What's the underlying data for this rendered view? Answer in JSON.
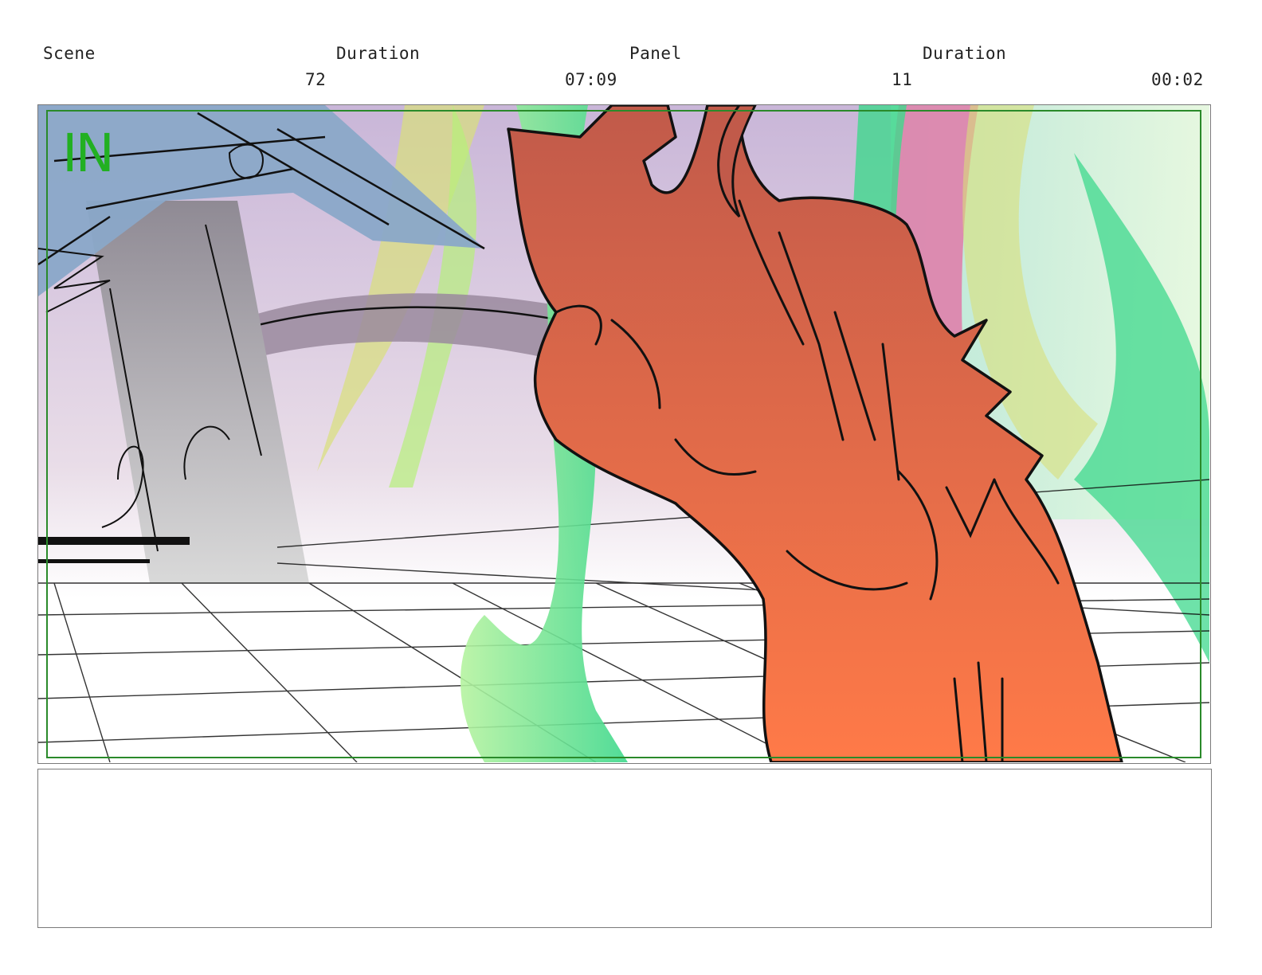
{
  "header": {
    "scene_label": "Scene",
    "scene_duration_label": "Duration",
    "panel_label": "Panel",
    "panel_duration_label": "Duration",
    "scene_number": "72",
    "scene_duration": "07:09",
    "panel_number": "11",
    "panel_duration": "00:02"
  },
  "panel": {
    "in_marker": "IN",
    "safe_frame_color": "#2a8a2a"
  },
  "colors": {
    "character_fill": "#e2684a",
    "sky_lavender": "#cdb9d6",
    "fx_green": "#4fd88a",
    "fx_pink": "#e07aa8",
    "fx_yellow": "#d8e07a",
    "weapon_blue": "#8aa8c8"
  }
}
